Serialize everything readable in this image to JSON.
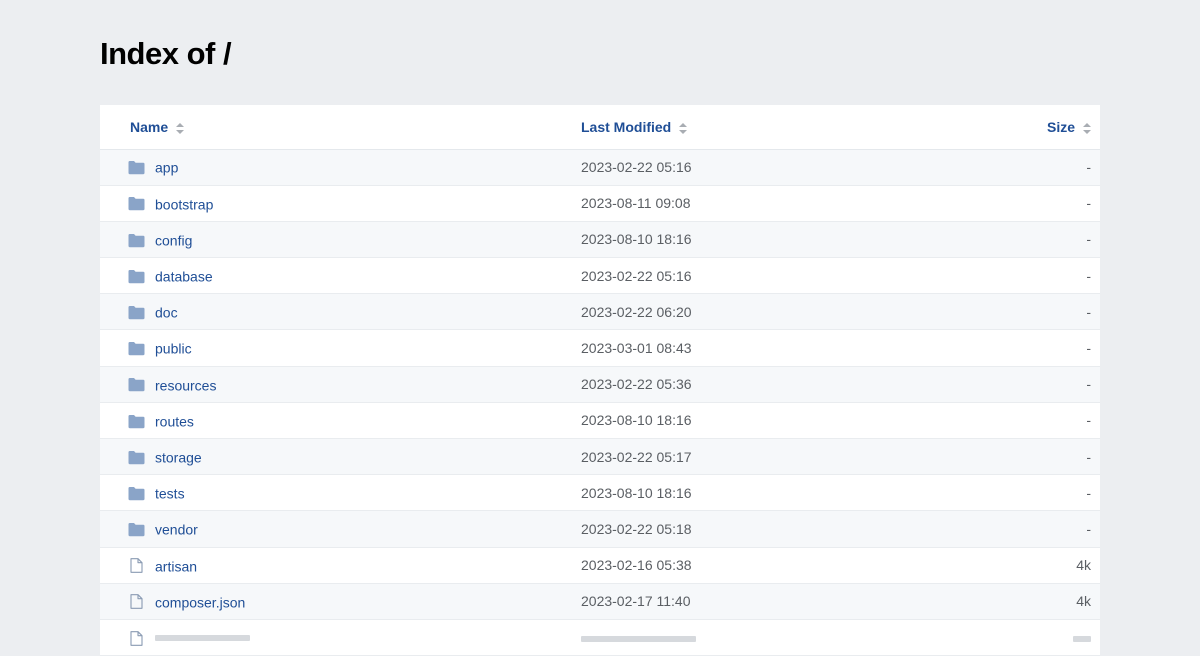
{
  "page": {
    "title": "Index of /"
  },
  "table": {
    "columns": {
      "name": "Name",
      "modified": "Last Modified",
      "size": "Size"
    },
    "rows": [
      {
        "type": "folder",
        "icon": "folder-icon",
        "name": "app",
        "modified": "2023-02-22 05:16",
        "size": "-"
      },
      {
        "type": "folder",
        "icon": "folder-icon",
        "name": "bootstrap",
        "modified": "2023-08-11 09:08",
        "size": "-"
      },
      {
        "type": "folder",
        "icon": "folder-icon",
        "name": "config",
        "modified": "2023-08-10 18:16",
        "size": "-"
      },
      {
        "type": "folder",
        "icon": "folder-icon",
        "name": "database",
        "modified": "2023-02-22 05:16",
        "size": "-"
      },
      {
        "type": "folder",
        "icon": "folder-icon",
        "name": "doc",
        "modified": "2023-02-22 06:20",
        "size": "-"
      },
      {
        "type": "folder",
        "icon": "folder-icon",
        "name": "public",
        "modified": "2023-03-01 08:43",
        "size": "-"
      },
      {
        "type": "folder",
        "icon": "folder-icon",
        "name": "resources",
        "modified": "2023-02-22 05:36",
        "size": "-"
      },
      {
        "type": "folder",
        "icon": "folder-icon",
        "name": "routes",
        "modified": "2023-08-10 18:16",
        "size": "-"
      },
      {
        "type": "folder",
        "icon": "folder-icon",
        "name": "storage",
        "modified": "2023-02-22 05:17",
        "size": "-"
      },
      {
        "type": "folder",
        "icon": "folder-icon",
        "name": "tests",
        "modified": "2023-08-10 18:16",
        "size": "-"
      },
      {
        "type": "folder",
        "icon": "folder-icon",
        "name": "vendor",
        "modified": "2023-02-22 05:18",
        "size": "-"
      },
      {
        "type": "file",
        "icon": "file-icon",
        "name": "artisan",
        "modified": "2023-02-16 05:38",
        "size": "4k"
      },
      {
        "type": "file",
        "icon": "file-icon",
        "name": "composer.json",
        "modified": "2023-02-17 11:40",
        "size": "4k"
      }
    ]
  },
  "colors": {
    "link": "#1f4e96",
    "folder_icon": "#8aa4c8",
    "file_icon": "#8a9bb3",
    "background": "#eceef1"
  }
}
